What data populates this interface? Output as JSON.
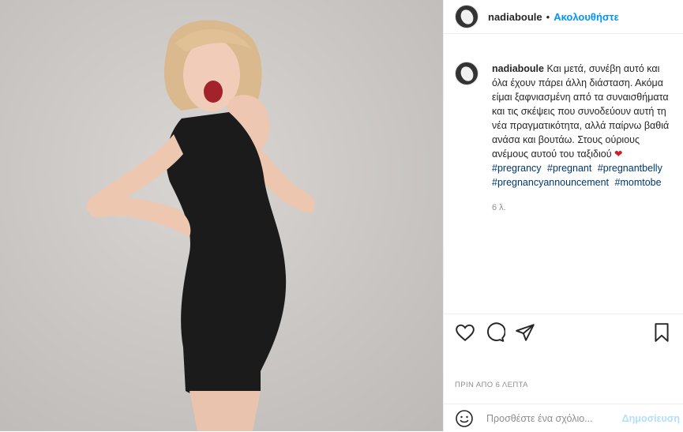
{
  "post": {
    "username": "nadiaboule",
    "follow_label": "Ακολουθήστε",
    "separator": "•",
    "caption_text": "Και μετά, συνέβη αυτό και όλα έχουν πάρει άλλη διάσταση. Ακόμα είμαι ξαφνιασμένη από τα συναισθήματα και τις σκέψεις που συνοδεύουν αυτή τη νέα πραγματικότητα, αλλά παίρνω βαθιά ανάσα και βουτάω. Στους ούριους ανέμους αυτού του ταξιδιού",
    "hashtags": [
      "#pregrancy",
      "#pregnant",
      "#pregnantbelly",
      "#pregnancyannouncement",
      "#momtobe"
    ],
    "caption_time": "6 λ.",
    "posted_ago": "ΠΡΙΝ ΑΠΟ 6 ΛΕΠΤΑ"
  },
  "comment": {
    "placeholder": "Προσθέστε ένα σχόλιο...",
    "publish_label": "Δημοσίευση"
  },
  "icons": [
    "heart-icon",
    "comment-icon",
    "share-icon",
    "bookmark-icon",
    "emoji-icon"
  ],
  "colors": {
    "accent": "#0095f6",
    "hashtag": "#00376b",
    "muted": "#8e8e8e",
    "publish_disabled": "#b2dffc",
    "photo_background": "#c9c6c3"
  }
}
